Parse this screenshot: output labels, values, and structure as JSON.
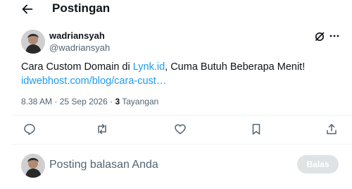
{
  "header": {
    "title": "Postingan",
    "back_icon": "arrow-left-icon"
  },
  "post": {
    "author_name": "wadriansyah",
    "author_handle": "@wadriansyah",
    "text_before": "Cara Custom Domain di ",
    "mention": "Lynk.id",
    "text_after": ", Cuma Butuh Beberapa Menit!",
    "url": "idwebhost.com/blog/cara-cust…",
    "time": "8.38 AM",
    "separator": " · ",
    "date": "25 Sep 2026",
    "views_count": "3",
    "views_label": " Tayangan"
  },
  "top_icons": [
    "grok-icon",
    "more-icon"
  ],
  "actions": [
    "reply-icon",
    "retweet-icon",
    "like-icon",
    "bookmark-icon",
    "share-icon"
  ],
  "reply": {
    "placeholder": "Posting balasan Anda",
    "button_label": "Balas"
  },
  "colors": {
    "accent": "#1d9bf0",
    "text": "#0f1419",
    "muted": "#536471",
    "divider": "#eff3f4",
    "button_disabled": "#dfe3e6"
  }
}
